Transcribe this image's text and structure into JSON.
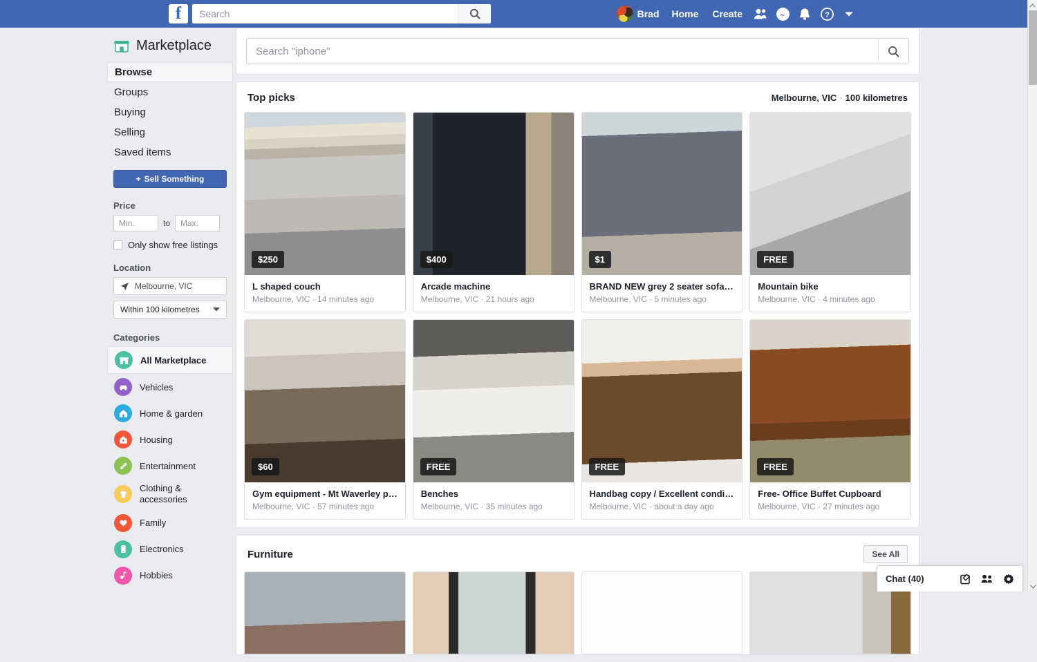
{
  "topbar": {
    "logo": "f",
    "search_placeholder": "Search",
    "search_value": "",
    "search_icon": "search-icon",
    "profile_name": "Brad",
    "home_label": "Home",
    "create_label": "Create",
    "icons": [
      "friend-requests-icon",
      "messenger-icon",
      "notifications-icon",
      "help-icon",
      "account-dropdown-icon"
    ],
    "brand_color": "#4267b2"
  },
  "sidebar": {
    "title": "Marketplace",
    "logo_icon": "marketplace-shop-icon",
    "nav": [
      {
        "label": "Browse",
        "active": true
      },
      {
        "label": "Groups",
        "active": false
      },
      {
        "label": "Buying",
        "active": false
      },
      {
        "label": "Selling",
        "active": false
      },
      {
        "label": "Saved items",
        "active": false
      }
    ],
    "sell_button": "Sell Something",
    "filters": {
      "price_heading": "Price",
      "price_min_placeholder": "Min.",
      "price_min_value": "",
      "price_to": "to",
      "price_max_placeholder": "Max.",
      "price_max_value": "",
      "free_listings_label": "Only show free listings",
      "free_listings_checked": false,
      "location_heading": "Location",
      "location_value": "Melbourne, VIC",
      "radius_value": "Within 100 kilometres"
    },
    "categories_heading": "Categories",
    "categories": [
      {
        "label": "All Marketplace",
        "icon": "all-marketplace-icon",
        "color": "#4dbfa4",
        "active": true
      },
      {
        "label": "Vehicles",
        "icon": "car-icon",
        "color": "#9361c9",
        "active": false
      },
      {
        "label": "Home & garden",
        "icon": "home-icon",
        "color": "#2eaae0",
        "active": false
      },
      {
        "label": "Housing",
        "icon": "housing-icon",
        "color": "#f0563a",
        "active": false
      },
      {
        "label": "Entertainment",
        "icon": "entertainment-icon",
        "color": "#8dc153",
        "active": false
      },
      {
        "label": "Clothing & accessories",
        "icon": "clothing-icon",
        "color": "#f5cb5c",
        "active": false
      },
      {
        "label": "Family",
        "icon": "heart-icon",
        "color": "#f0563a",
        "active": false
      },
      {
        "label": "Electronics",
        "icon": "phone-icon",
        "color": "#4dbfa4",
        "active": false
      },
      {
        "label": "Hobbies",
        "icon": "hobbies-icon",
        "color": "#ef55a8",
        "active": false
      }
    ]
  },
  "main": {
    "search_placeholder": "Search \"iphone\"",
    "search_value": "",
    "search_icon": "search-icon",
    "top_picks": {
      "title": "Top picks",
      "location": "Melbourne, VIC",
      "radius": "100 kilometres",
      "items": [
        {
          "price": "$250",
          "title": "L shaped couch",
          "location": "Melbourne, VIC",
          "time": "14 minutes ago",
          "img": "l-shaped-couch"
        },
        {
          "price": "$400",
          "title": "Arcade machine",
          "location": "Melbourne, VIC",
          "time": "21 hours ago",
          "img": "arcade-machine"
        },
        {
          "price": "$1",
          "title": "BRAND NEW grey 2 seater sofa …",
          "location": "Melbourne, VIC",
          "time": "5 minutes ago",
          "img": "grey-sofa"
        },
        {
          "price": "FREE",
          "title": "Mountain bike",
          "location": "Melbourne, VIC",
          "time": "4 minutes ago",
          "img": "mountain-bike"
        },
        {
          "price": "$60",
          "title": "Gym equipment - Mt Waverley pi…",
          "location": "Melbourne, VIC",
          "time": "57 minutes ago",
          "img": "gym-equipment"
        },
        {
          "price": "FREE",
          "title": "Benches",
          "location": "Melbourne, VIC",
          "time": "35 minutes ago",
          "img": "benches"
        },
        {
          "price": "FREE",
          "title": "Handbag copy / Excellent condit…",
          "location": "Melbourne, VIC",
          "time": "about a day ago",
          "img": "handbag"
        },
        {
          "price": "FREE",
          "title": "Free- Office Buffet Cupboard",
          "location": "Melbourne, VIC",
          "time": "27 minutes ago",
          "img": "office-buffet"
        }
      ]
    },
    "furniture": {
      "title": "Furniture",
      "see_all": "See All",
      "items": [
        {
          "img": "recliner-sofa"
        },
        {
          "img": "display-cabinet"
        },
        {
          "img": "white-shelf"
        },
        {
          "img": "bedroom-furniture"
        }
      ]
    }
  },
  "chat": {
    "label": "Chat (40)",
    "icons": [
      "new-message-icon",
      "group-chat-icon",
      "chat-settings-icon"
    ]
  }
}
